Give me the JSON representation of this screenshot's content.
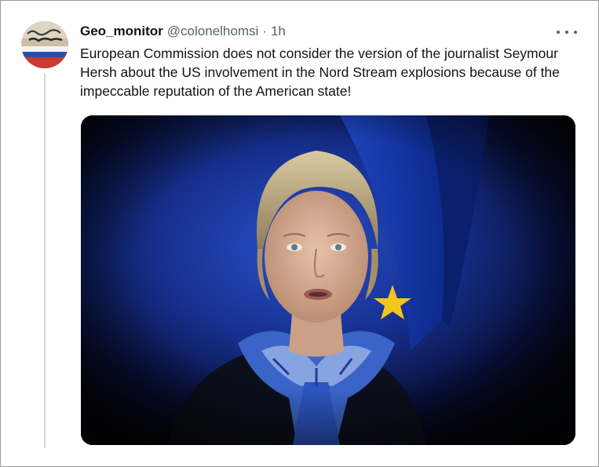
{
  "tweet": {
    "display_name": "Geo_monitor",
    "handle": "@colonelhomsi",
    "separator": "·",
    "timestamp": "1h",
    "text": "European Commission does not consider the version of the journalist Seymour Hersh about the US involvement in the Nord Stream explosions because of the impeccable reputation of the American state!",
    "more_icon": "more-horizontal-icon"
  },
  "avatar": {
    "icon": "avatar-image"
  },
  "media": {
    "icon": "photo",
    "colors": {
      "background": "#0c1a5c",
      "flag_star": "#f2c51c",
      "scarf": "#3a64c8"
    }
  }
}
